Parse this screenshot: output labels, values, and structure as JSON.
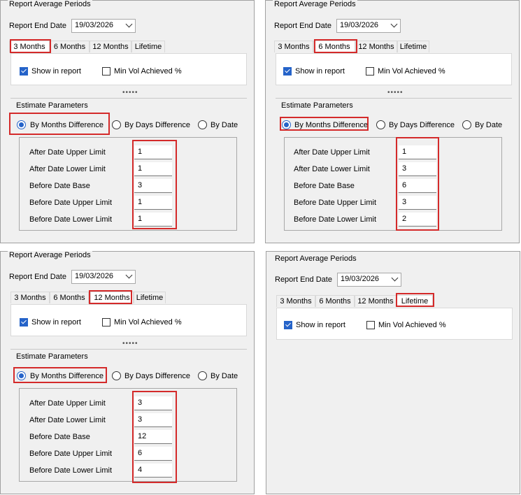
{
  "group_title": "Report Average Periods",
  "report_end_date_label": "Report End Date",
  "report_end_date": "19/03/2026",
  "tabs": [
    "3 Months",
    "6 Months",
    "12 Months",
    "Lifetime"
  ],
  "show_in_report_label": "Show in report",
  "min_vol_label": "Min Vol Achieved %",
  "dots": "•••••",
  "estimate_title": "Estimate Parameters",
  "radio_options": [
    "By Months Difference",
    "By Days Difference",
    "By Date"
  ],
  "param_labels": [
    "After Date Upper Limit",
    "After Date Lower Limit",
    "Before Date Base",
    "Before Date Upper Limit",
    "Before Date Lower Limit"
  ],
  "panels": {
    "three_months": {
      "active_tab": "3 Months",
      "show_in_report": true,
      "min_vol_achieved": false,
      "selected_option": "By Months Difference",
      "values": [
        "1",
        "1",
        "3",
        "1",
        "1"
      ]
    },
    "six_months": {
      "active_tab": "6 Months",
      "show_in_report": true,
      "min_vol_achieved": false,
      "selected_option": "By Months Difference",
      "values": [
        "1",
        "3",
        "6",
        "3",
        "2"
      ]
    },
    "twelve_months": {
      "active_tab": "12 Months",
      "show_in_report": true,
      "min_vol_achieved": false,
      "selected_option": "By Months Difference",
      "values": [
        "3",
        "3",
        "12",
        "6",
        "4"
      ]
    },
    "lifetime": {
      "active_tab": "Lifetime",
      "show_in_report": true,
      "min_vol_achieved": false
    }
  },
  "colors": {
    "highlight": "#d42a2a",
    "accent": "#2563c9",
    "panel_bg": "#f0f0f0"
  }
}
